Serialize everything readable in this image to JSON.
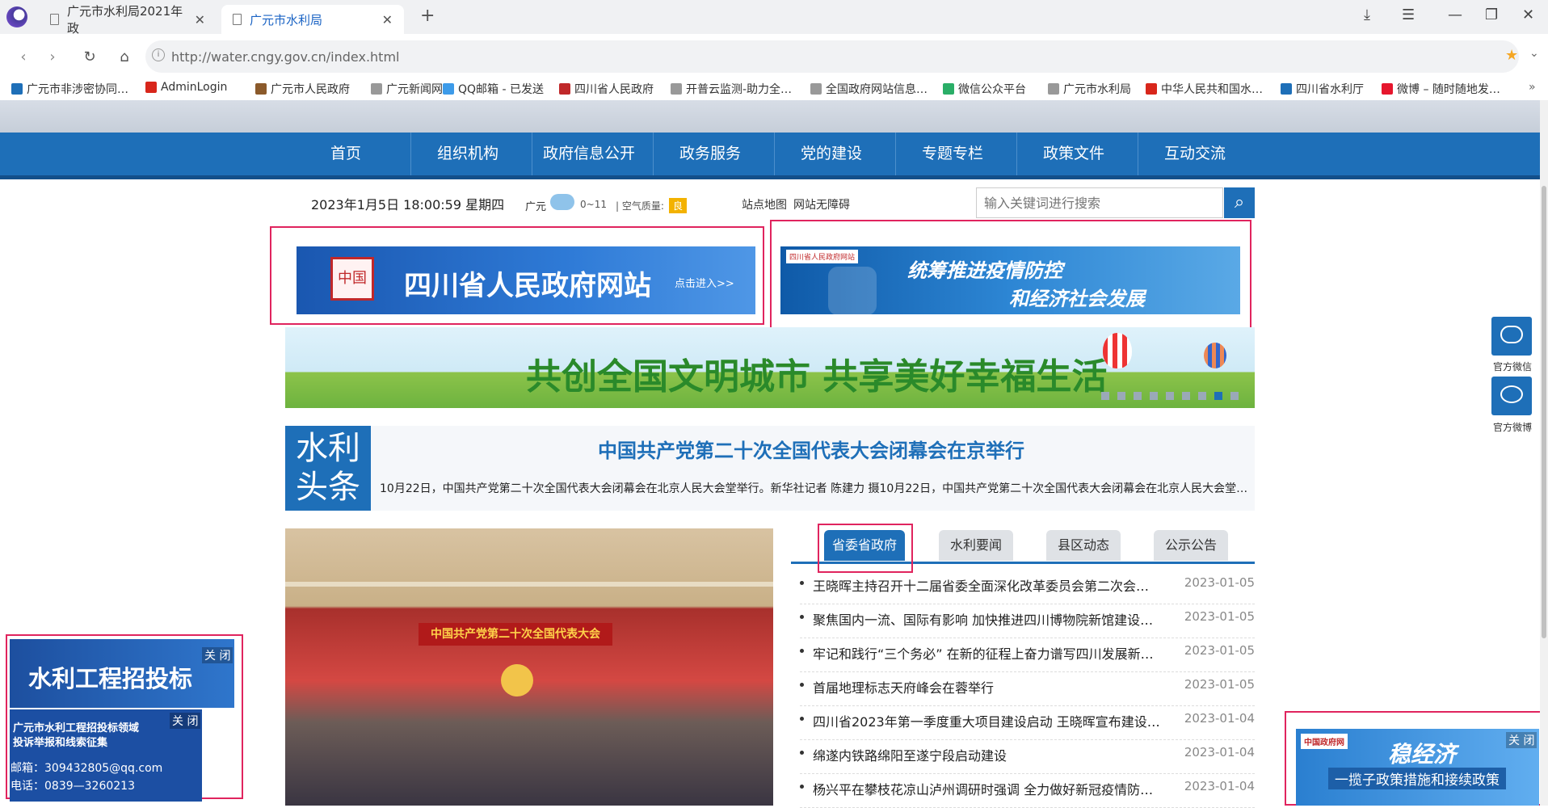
{
  "browser": {
    "tabs": [
      {
        "label": "广元市水利局2021年政",
        "active": false
      },
      {
        "label": "广元市水利局",
        "active": true
      }
    ],
    "new_tab": "+",
    "url": "http://water.cngy.gov.cn/index.html",
    "bookmarks": [
      {
        "label": "广元市非涉密协同…",
        "icon": "oa-icon",
        "color": "#1e6fb8"
      },
      {
        "label": "AdminLogin",
        "icon": "emblem-icon",
        "color": "#d8261b"
      },
      {
        "label": "广元市人民政府",
        "icon": "flag-icon",
        "color": "#8b5a2b"
      },
      {
        "label": "广元新闻网",
        "icon": "page-icon",
        "color": "#999999"
      },
      {
        "label": "QQ邮箱 - 已发送",
        "icon": "qq-icon",
        "color": "#3d9be9"
      },
      {
        "label": "四川省人民政府",
        "icon": "seal-icon",
        "color": "#c0282a"
      },
      {
        "label": "开普云监测-助力全…",
        "icon": "page-icon",
        "color": "#999999"
      },
      {
        "label": "全国政府网站信息…",
        "icon": "page-icon",
        "color": "#999999"
      },
      {
        "label": "微信公众平台",
        "icon": "wechat-icon",
        "color": "#2aae67"
      },
      {
        "label": "广元市水利局",
        "icon": "page-icon",
        "color": "#999999"
      },
      {
        "label": "中华人民共和国水…",
        "icon": "emblem-icon",
        "color": "#d8261b"
      },
      {
        "label": "四川省水利厅",
        "icon": "water-icon",
        "color": "#1e6fb8"
      },
      {
        "label": "微博 – 随时随地发…",
        "icon": "weibo-icon",
        "color": "#e6162d"
      }
    ]
  },
  "nav": [
    "首页",
    "组织机构",
    "政府信息公开",
    "政务服务",
    "党的建设",
    "专题专栏",
    "政策文件",
    "互动交流"
  ],
  "topbar": {
    "date": "2023年1月5日 18:00:59 星期四",
    "city": "广元",
    "temp": "0~11",
    "air_label": "| 空气质量:",
    "air_value": "良",
    "sitemap": "站点地图",
    "accessible": "网站无障碍",
    "search_placeholder": "输入关键词进行搜索"
  },
  "banners": {
    "sc_gov_title": "四川省人民政府网站",
    "sc_gov_seal": "中国",
    "sc_gov_enter": "点击进入>>",
    "covid_logo": "四川省人民政府网站",
    "covid_line1": "统筹推进疫情防控",
    "covid_line2": "和经济社会发展",
    "civilized_city": "共创全国文明城市 共享美好幸福生活"
  },
  "headline": {
    "badge_line1": "水利",
    "badge_line2": "头条",
    "title": "中国共产党第二十次全国代表大会闭幕会在京举行",
    "summary": "10月22日，中国共产党第二十次全国代表大会闭幕会在北京人民大会堂举行。新华社记者 陈建力 摄10月22日，中国共产党第二十次全国代表大会闭幕会在北京人民大会堂…"
  },
  "photo_banner": "中国共产党第二十次全国代表大会",
  "news_tabs": [
    "省委省政府",
    "水利要闻",
    "县区动态",
    "公示公告"
  ],
  "news": [
    {
      "title": "王晓晖主持召开十二届省委全面深化改革委员会第二次会…",
      "date": "2023-01-05"
    },
    {
      "title": "聚焦国内一流、国际有影响 加快推进四川博物院新馆建设…",
      "date": "2023-01-05"
    },
    {
      "title": "牢记和践行“三个务必” 在新的征程上奋力谱写四川发展新…",
      "date": "2023-01-05"
    },
    {
      "title": "首届地理标志天府峰会在蓉举行",
      "date": "2023-01-05"
    },
    {
      "title": "四川省2023年第一季度重大项目建设启动 王晓晖宣布建设…",
      "date": "2023-01-04"
    },
    {
      "title": "绵遂内铁路绵阳至遂宁段启动建设",
      "date": "2023-01-04"
    },
    {
      "title": "杨兴平在攀枝花凉山泸州调研时强调 全力做好新冠疫情防…",
      "date": "2023-01-04"
    }
  ],
  "side": {
    "wechat": "官方微信",
    "weibo": "官方微博"
  },
  "float_left": {
    "title": "水利工程招投标",
    "close": "关 闭",
    "line1": "广元市水利工程招投标领域",
    "line2": "投诉举报和线索征集",
    "email": "邮箱：309432805@qq.com",
    "phone": "电话：0839—3260213"
  },
  "float_right": {
    "logo": "中国政府网",
    "title": "稳经济",
    "subtitle": "一揽子政策措施和接续政策",
    "close": "关 闭"
  }
}
